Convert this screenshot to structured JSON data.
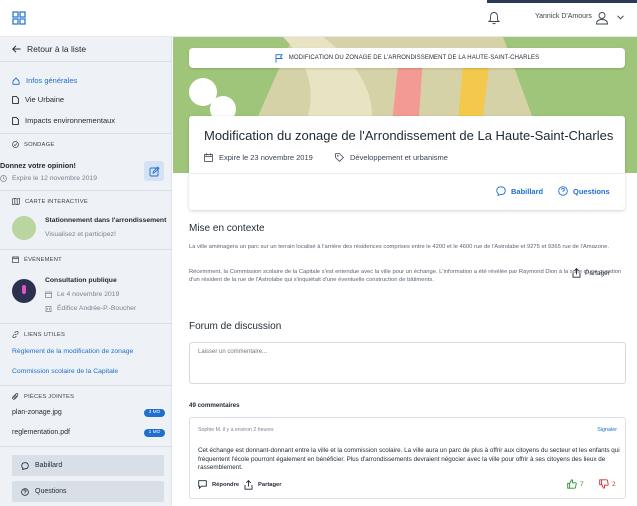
{
  "header": {
    "user_name": "Yannick D'Amours",
    "icons": [
      "grid-logo-icon",
      "bell-icon",
      "person-icon",
      "chevron-down-icon"
    ]
  },
  "sidebar": {
    "back_label": "Retour à la liste",
    "nav": [
      {
        "label": "Infos générales",
        "icon": "home-icon",
        "active": true
      },
      {
        "label": "Vie Urbaine",
        "icon": "document-icon",
        "active": false
      },
      {
        "label": "Impacts environnementaux",
        "icon": "document-icon",
        "active": false
      }
    ],
    "sondage": {
      "section_label": "SONDAGE",
      "title": "Donnez votre opinion!",
      "expiry": "Expire le 12 novembre 2019"
    },
    "carte": {
      "section_label": "CARTE INTERACTIVE",
      "title": "Stationnement dans l'arrondissement",
      "subtitle": "Visualisez et participez!"
    },
    "evenement": {
      "section_label": "ÉVÉNEMENT",
      "title": "Consultation publique",
      "date": "Le 4 novembre 2019",
      "place": "Édifice Andrée-P.-Boucher"
    },
    "liens": {
      "section_label": "LIENS UTILES",
      "links": [
        "Règlement de la modification de zonage",
        "Commission scolaire de la Capitale"
      ]
    },
    "pieces": {
      "section_label": "PIÈCES JOINTES",
      "files": [
        {
          "name": "plan-zonage.jpg",
          "size": "3 MO"
        },
        {
          "name": "reglementation.pdf",
          "size": "1 MO"
        }
      ]
    },
    "buttons": {
      "babillard": "Babillard",
      "questions": "Questions"
    }
  },
  "hero": {
    "banner": "MODIFICATION DU ZONAGE DE L'ARRONDISSEMENT DE LA HAUTE-SAINT-CHARLES"
  },
  "card": {
    "title": "Modification du zonage de l'Arrondissement de La Haute-Saint-Charles",
    "expiry": "Expire le 23 novembre 2019",
    "category": "Développement et urbanisme",
    "babillard": "Babillard",
    "questions": "Questions"
  },
  "context": {
    "heading": "Mise en contexte",
    "p1": "La ville aménagera un parc sur un terrain localisé à l'arrière des résidences comprises entre le 4200 et le 4600 rue de l'Astrolabe et 9275 et 9365 rue de l'Amazone.",
    "p2": "Récemment, la Commission scolaire de la Capitale s'est entendue avec la ville pour un échange. L'information a été révélée par Raymond Dion à la suite d'une question d'un résident de la rue de l'Astrolabe qui s'inquiétait d'une éventuelle construction de bâtiments.",
    "share": "Partager"
  },
  "forum": {
    "heading": "Forum de discussion",
    "placeholder": "Laisser un commentaire...",
    "count": "49 commentaires",
    "comment": {
      "author": "Sophie M. il y a environ 2 heures",
      "report": "Signaler",
      "body": "Cet échange est donnant-donnant entre la ville et la commission scolaire. La ville aura un parc de plus à offrir aux citoyens du secteur et les enfants qui fréquentent l'école pourront également en bénéficier. Plus d'arrondissements devraient négocier avec la ville pour offrir à ses citoyens des lieux de rassemblement.",
      "reply": "Répondre",
      "share": "Partager",
      "likes": "7",
      "dislikes": "2"
    }
  },
  "colors": {
    "accent": "#1f6fcf",
    "sidebar_bg": "#eef1f5",
    "like": "#2e8b2e",
    "dislike": "#d12b2b"
  }
}
